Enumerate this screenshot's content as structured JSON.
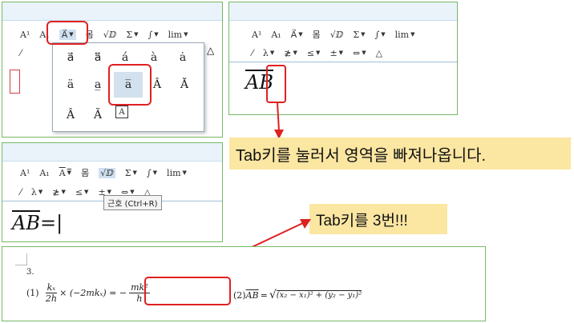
{
  "toolbar_top": [
    "A¹",
    "A₁",
    "A⃗",
    "몸",
    "√ⅅ",
    "Σ",
    "∫",
    "lim"
  ],
  "toolbar_bottom": [
    "⁄",
    "λ",
    "≵",
    "≤",
    "±",
    "⇔",
    "△"
  ],
  "panel4_toolbar_top": [
    "A¹",
    "A₁",
    "A",
    "몸",
    "√ⅅ",
    "Σ",
    "∫",
    "lim"
  ],
  "accent_grid": [
    [
      "a⃗",
      "a⃡",
      "á",
      "à",
      "ȧ"
    ],
    [
      "ä",
      "a̲",
      "a̅",
      "Â",
      "Ă"
    ],
    [
      "Â",
      "Ã",
      "A"
    ]
  ],
  "tooltip": "근호 (Ctrl+R)",
  "equation_ab": "AB",
  "equation_ab_eq": "AB=",
  "callout1": "Tab키를 눌러서 영역을 빠져나옵니다.",
  "callout2": "Tab키를 3번!!!",
  "doc": {
    "number": "3.",
    "eq1_prefix": "(1)",
    "eq1_frac_num": "kₓ",
    "eq1_frac_den": "2h",
    "eq1_mid": "× (−2mkₓ) = −",
    "eq1_frac2_num": "mk²",
    "eq1_frac2_den": "h",
    "eq2_prefix": "(2)",
    "eq2_ab": "AB",
    "eq2_eq": "=",
    "eq2_root": "(x₂ − x₁)² + (y₂ − y₁)²"
  },
  "colors": {
    "red": "#e02020",
    "callout": "#fbe6a2",
    "panel_border": "#77b766",
    "ribbon": "#eaf3fa"
  }
}
